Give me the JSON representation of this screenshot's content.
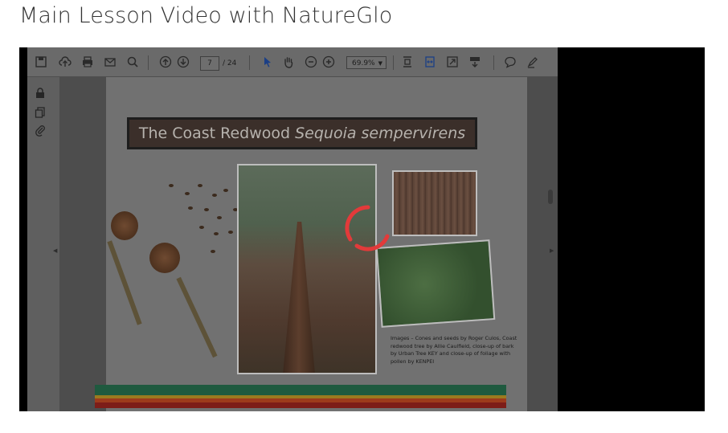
{
  "page": {
    "title": "Main Lesson Video with NatureGlo"
  },
  "reader": {
    "toolbar": {
      "current_page": "7",
      "total_pages": "/ 24",
      "zoom": "69.9%",
      "icons": [
        "save-icon",
        "cloud-upload-icon",
        "print-icon",
        "email-icon",
        "search-icon",
        "page-up-icon",
        "page-down-icon",
        "select-cursor-icon",
        "hand-tool-icon",
        "zoom-out-icon",
        "zoom-in-icon",
        "fit-page-icon",
        "fit-width-icon",
        "full-screen-icon",
        "scroll-mode-icon",
        "comment-icon",
        "highlight-icon"
      ]
    },
    "rail_icons": [
      "lock-icon",
      "copy-pages-icon",
      "attachment-icon"
    ]
  },
  "slide": {
    "title_plain": "The Coast Redwood",
    "title_italic": "Sequoia sempervirens",
    "caption": "Images – Cones and seeds by  Roger Culos, Coast redwood tree by Allie Caulfield, close-up of bark by Urban Tree KEY and close-up of foliage with pollen by KENPEI"
  },
  "colors": {
    "loader_accent": "#e23a3a",
    "band_green": "#1f5a3f",
    "band_red": "#7d1d18"
  }
}
